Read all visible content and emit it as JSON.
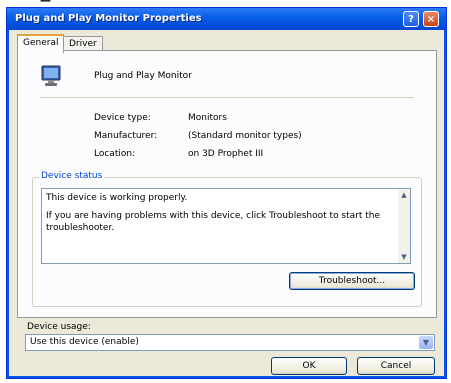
{
  "window": {
    "title": "Plug and Play Monitor Properties",
    "help_glyph": "?",
    "close_glyph": "×"
  },
  "tabs": [
    {
      "label": "General",
      "active": true
    },
    {
      "label": "Driver",
      "active": false
    }
  ],
  "general": {
    "device_name": "Plug and Play Monitor",
    "icon": "monitor-icon",
    "properties": [
      {
        "label": "Device type:",
        "value": "Monitors"
      },
      {
        "label": "Manufacturer:",
        "value": "(Standard monitor types)"
      },
      {
        "label": "Location:",
        "value": "on 3D Prophet III"
      }
    ],
    "device_status": {
      "group_label": "Device status",
      "line1": "This device is working properly.",
      "line2": "If you are having problems with this device, click Troubleshoot to start the troubleshooter."
    },
    "troubleshoot_label": "Troubleshoot...",
    "device_usage": {
      "label": "Device usage:",
      "selected": "Use this device (enable)"
    }
  },
  "buttons": {
    "ok": "OK",
    "cancel": "Cancel"
  },
  "colors": {
    "titlebar": "#0a5fea",
    "dialog_bg": "#ece9d8",
    "group_label": "#0046d5",
    "active_tab_accent": "#e6a33a"
  }
}
